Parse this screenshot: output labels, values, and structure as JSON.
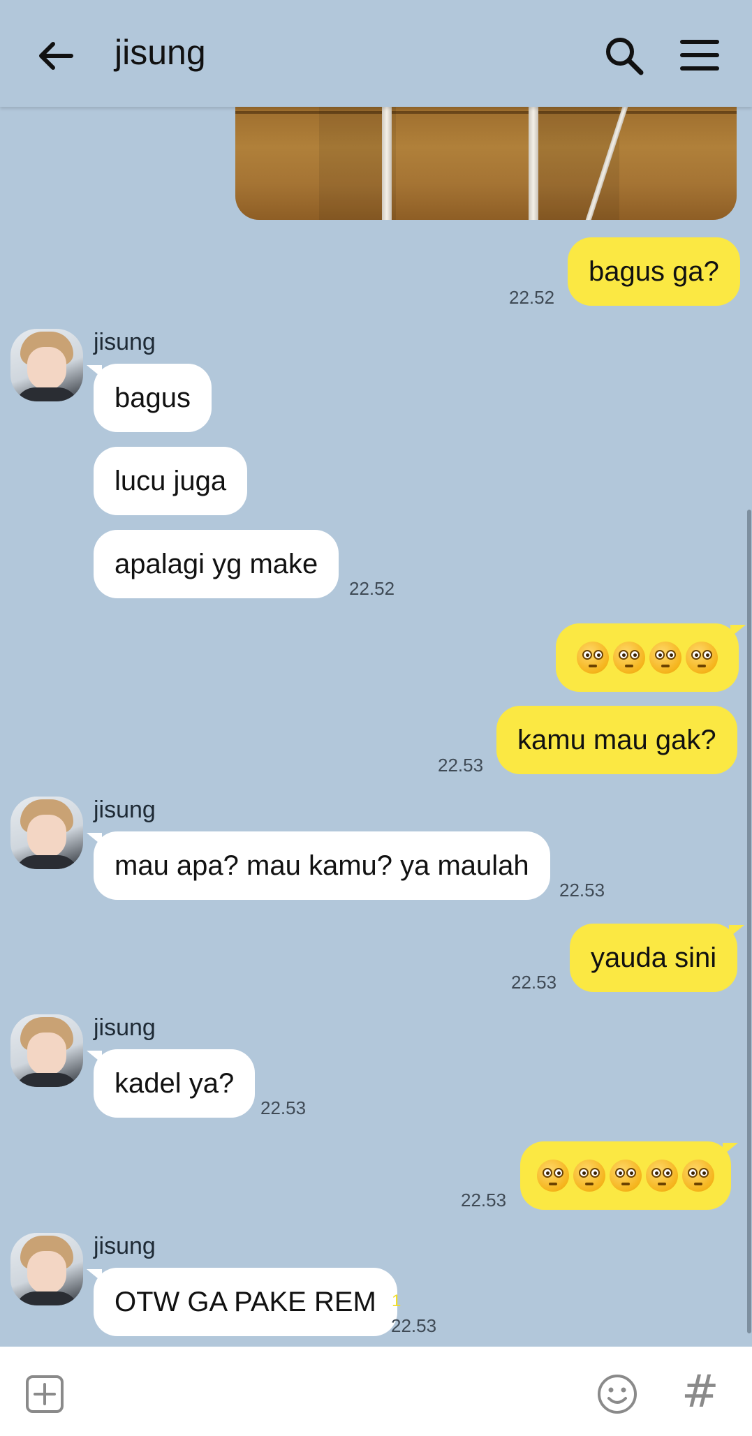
{
  "header": {
    "title": "jisung",
    "back_icon": "arrow-left-icon",
    "search_icon": "search-icon",
    "menu_icon": "menu-icon"
  },
  "messages": [
    {
      "from": "me",
      "text": "bagus ga?",
      "time": "22.52"
    },
    {
      "from": "them",
      "sender": "jisung",
      "text": "bagus"
    },
    {
      "from": "them",
      "text": "lucu juga"
    },
    {
      "from": "them",
      "text": "apalagi yg make",
      "time": "22.52"
    },
    {
      "from": "me",
      "emoji_count": 4,
      "emoji": "flushed-face"
    },
    {
      "from": "me",
      "text": "kamu mau gak?",
      "time": "22.53"
    },
    {
      "from": "them",
      "sender": "jisung",
      "text": "mau apa? mau kamu? ya maulah",
      "time": "22.53"
    },
    {
      "from": "me",
      "text": "yauda sini",
      "time": "22.53"
    },
    {
      "from": "them",
      "sender": "jisung",
      "text": "kadel ya?",
      "time": "22.53"
    },
    {
      "from": "me",
      "emoji_count": 5,
      "emoji": "flushed-face",
      "time": "22.53"
    },
    {
      "from": "them",
      "sender": "jisung",
      "text": "OTW GA PAKE REM",
      "unread": "1",
      "time": "22.53"
    }
  ],
  "input_bar": {
    "attach_icon": "plus-square-icon",
    "emoji_icon": "smile-icon",
    "hashtag_label": "#"
  },
  "colors": {
    "background": "#b2c7da",
    "my_bubble": "#fbe843",
    "their_bubble": "#ffffff",
    "unread": "#f2de28"
  }
}
